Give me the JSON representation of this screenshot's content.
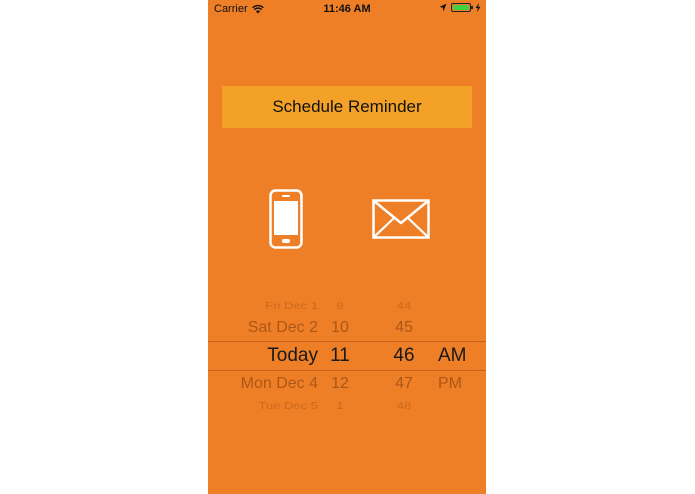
{
  "status_bar": {
    "carrier": "Carrier",
    "time": "11:46 AM"
  },
  "schedule_button": {
    "label": "Schedule Reminder"
  },
  "channels": {
    "phone_icon": "smartphone-icon",
    "mail_icon": "envelope-icon"
  },
  "picker": {
    "rows": [
      {
        "date": "Fri Dec 1",
        "hour": "9",
        "minute": "44",
        "ampm": ""
      },
      {
        "date": "Sat Dec 2",
        "hour": "10",
        "minute": "45",
        "ampm": ""
      },
      {
        "date": "Today",
        "hour": "11",
        "minute": "46",
        "ampm": "AM"
      },
      {
        "date": "Mon Dec 4",
        "hour": "12",
        "minute": "47",
        "ampm": "PM"
      },
      {
        "date": "Tue Dec 5",
        "hour": "1",
        "minute": "48",
        "ampm": ""
      }
    ]
  },
  "colors": {
    "background": "#ee7f27",
    "button": "#f3a227",
    "battery": "#3fd13f"
  }
}
